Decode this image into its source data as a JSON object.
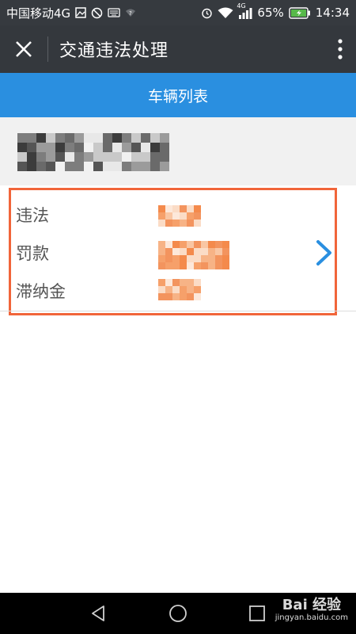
{
  "status_bar": {
    "carrier": "中国移动4G",
    "battery_percent": "65%",
    "time": "14:34",
    "network_badge": "4G",
    "icons": [
      "image-icon",
      "no-disturb-icon",
      "keyboard-icon",
      "wifi-question-icon",
      "alarm-icon",
      "wifi-icon",
      "signal-icon",
      "battery-charging-icon"
    ]
  },
  "app_bar": {
    "title": "交通违法处理",
    "close_icon": "close-icon",
    "more_icon": "more-vertical-icon"
  },
  "tab_bar": {
    "label": "车辆列表"
  },
  "vehicle_card": {
    "plate_redacted": true,
    "rows": [
      {
        "label": "违法",
        "value_redacted": true
      },
      {
        "label": "罚款",
        "value_redacted": true
      },
      {
        "label": "滞纳金",
        "value_redacted": true
      }
    ],
    "highlight_color": "#f1653a",
    "chevron_icon": "chevron-right-icon"
  },
  "nav_bar": {
    "icons": [
      "back-icon",
      "home-icon",
      "recents-icon"
    ]
  },
  "watermark": {
    "brand": "Bai 经验",
    "url": "jingyan.baidu.com"
  },
  "colors": {
    "status_bar": "#363a3f",
    "app_bar": "#34383d",
    "tab_bar": "#2a8fe0",
    "chevron": "#2a8fe0"
  }
}
